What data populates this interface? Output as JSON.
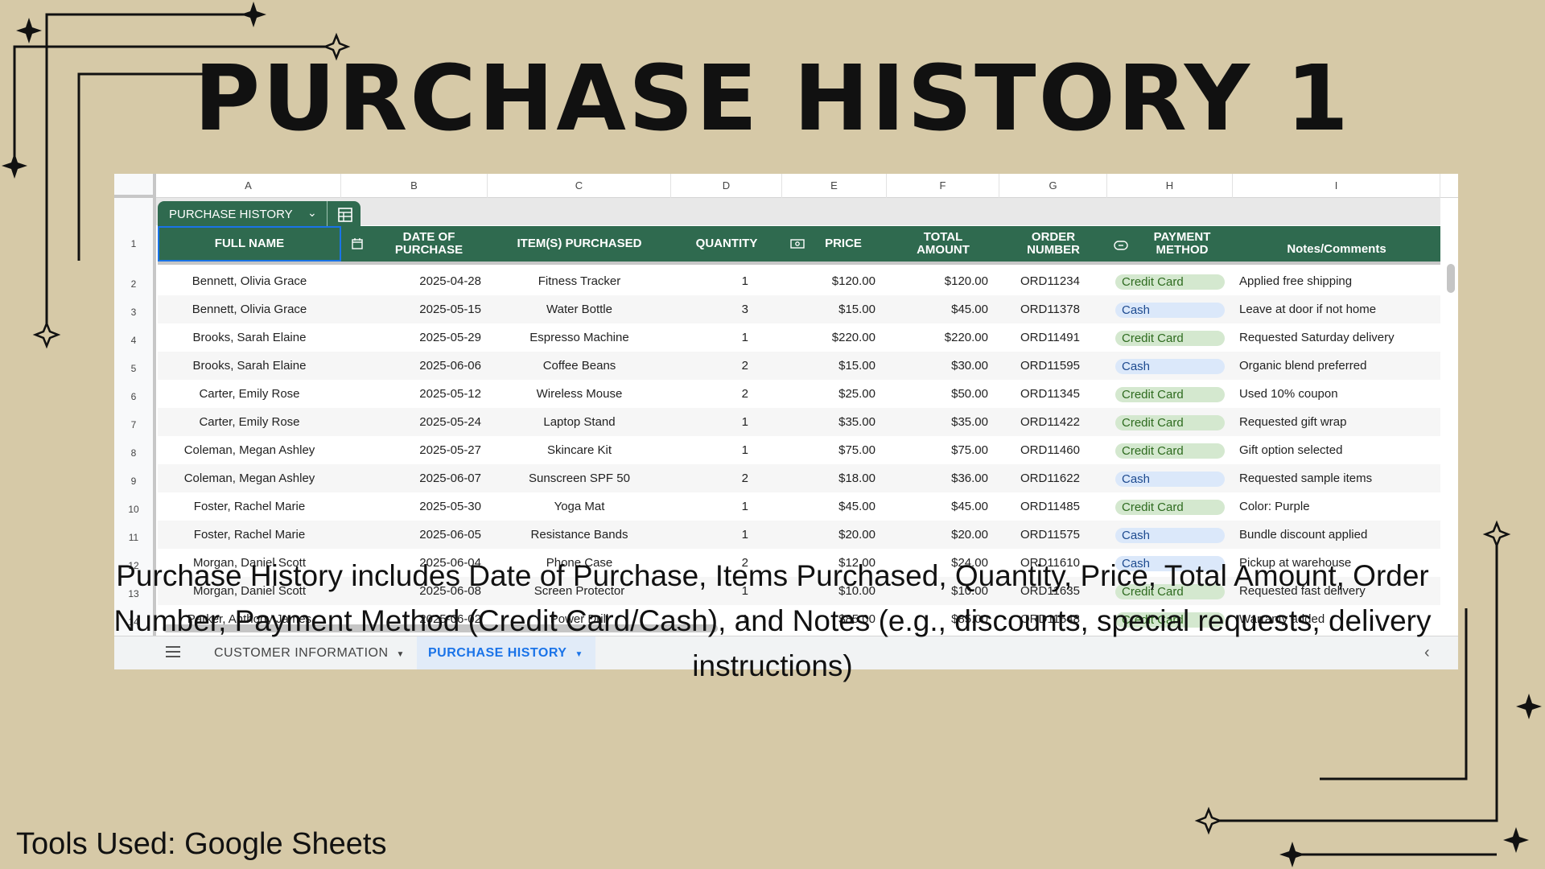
{
  "page": {
    "title": "PURCHASE HISTORY 1",
    "description": "Purchase History includes Date of Purchase, Items Purchased, Quantity, Price, Total Amount, Order Number, Payment Method (Credit Card/Cash), and Notes (e.g., discounts, special requests, delivery instructions)",
    "tools": "Tools Used: Google Sheets"
  },
  "colors": {
    "background": "#d6c9a7",
    "header_green": "#2f6a4f",
    "credit_card_chip": "#d4e8cf",
    "cash_chip": "#dbe8fa",
    "active_tab": "#1a73e8"
  },
  "sheet": {
    "column_letters": [
      "A",
      "B",
      "C",
      "D",
      "E",
      "F",
      "G",
      "H",
      "I"
    ],
    "row_numbers": [
      "1",
      "2",
      "3",
      "4",
      "5",
      "6",
      "7",
      "8",
      "9",
      "10",
      "11",
      "12",
      "13",
      "14"
    ],
    "table_name": "PURCHASE HISTORY",
    "headers": {
      "full_name": "FULL NAME",
      "date": "DATE OF\nPURCHASE",
      "items": "ITEM(S) PURCHASED",
      "quantity": "QUANTITY",
      "price": "PRICE",
      "total": "TOTAL\nAMOUNT",
      "order": "ORDER\nNUMBER",
      "payment": "PAYMENT\nMETHOD",
      "notes": "Notes/Comments"
    },
    "header_icons": {
      "table": "table-icon",
      "date": "calendar-icon",
      "price": "money-icon",
      "payment": "dropdown-chip-icon",
      "table_menu": "chevron-down-icon"
    },
    "rows": [
      {
        "name": "Bennett, Olivia Grace",
        "date": "2025-04-28",
        "item": "Fitness Tracker",
        "qty": "1",
        "price": "$120.00",
        "total": "$120.00",
        "order": "ORD11234",
        "payment": "Credit Card",
        "notes": "Applied free shipping"
      },
      {
        "name": "Bennett, Olivia Grace",
        "date": "2025-05-15",
        "item": "Water Bottle",
        "qty": "3",
        "price": "$15.00",
        "total": "$45.00",
        "order": "ORD11378",
        "payment": "Cash",
        "notes": "Leave at door if not home"
      },
      {
        "name": "Brooks, Sarah Elaine",
        "date": "2025-05-29",
        "item": "Espresso Machine",
        "qty": "1",
        "price": "$220.00",
        "total": "$220.00",
        "order": "ORD11491",
        "payment": "Credit Card",
        "notes": "Requested Saturday delivery"
      },
      {
        "name": "Brooks, Sarah Elaine",
        "date": "2025-06-06",
        "item": "Coffee Beans",
        "qty": "2",
        "price": "$15.00",
        "total": "$30.00",
        "order": "ORD11595",
        "payment": "Cash",
        "notes": "Organic blend preferred"
      },
      {
        "name": "Carter, Emily Rose",
        "date": "2025-05-12",
        "item": "Wireless Mouse",
        "qty": "2",
        "price": "$25.00",
        "total": "$50.00",
        "order": "ORD11345",
        "payment": "Credit Card",
        "notes": "Used 10% coupon"
      },
      {
        "name": "Carter, Emily Rose",
        "date": "2025-05-24",
        "item": "Laptop Stand",
        "qty": "1",
        "price": "$35.00",
        "total": "$35.00",
        "order": "ORD11422",
        "payment": "Credit Card",
        "notes": "Requested gift wrap"
      },
      {
        "name": "Coleman, Megan Ashley",
        "date": "2025-05-27",
        "item": "Skincare Kit",
        "qty": "1",
        "price": "$75.00",
        "total": "$75.00",
        "order": "ORD11460",
        "payment": "Credit Card",
        "notes": "Gift option selected"
      },
      {
        "name": "Coleman, Megan Ashley",
        "date": "2025-06-07",
        "item": "Sunscreen SPF 50",
        "qty": "2",
        "price": "$18.00",
        "total": "$36.00",
        "order": "ORD11622",
        "payment": "Cash",
        "notes": "Requested sample items"
      },
      {
        "name": "Foster, Rachel Marie",
        "date": "2025-05-30",
        "item": "Yoga Mat",
        "qty": "1",
        "price": "$45.00",
        "total": "$45.00",
        "order": "ORD11485",
        "payment": "Credit Card",
        "notes": "Color: Purple"
      },
      {
        "name": "Foster, Rachel Marie",
        "date": "2025-06-05",
        "item": "Resistance Bands",
        "qty": "1",
        "price": "$20.00",
        "total": "$20.00",
        "order": "ORD11575",
        "payment": "Cash",
        "notes": "Bundle discount applied"
      },
      {
        "name": "Morgan, Daniel Scott",
        "date": "2025-06-04",
        "item": "Phone Case",
        "qty": "2",
        "price": "$12.00",
        "total": "$24.00",
        "order": "ORD11610",
        "payment": "Cash",
        "notes": "Pickup at warehouse"
      },
      {
        "name": "Morgan, Daniel Scott",
        "date": "2025-06-08",
        "item": "Screen Protector",
        "qty": "1",
        "price": "$10.00",
        "total": "$10.00",
        "order": "ORD11635",
        "payment": "Credit Card",
        "notes": "Requested fast delivery"
      },
      {
        "name": "Parker, Anthony James",
        "date": "2025-06-02",
        "item": "Power Drill",
        "qty": "1",
        "price": "$85.00",
        "total": "$85.00",
        "order": "ORD11548",
        "payment": "Credit Card",
        "notes": "Warranty added"
      }
    ],
    "tabs": [
      {
        "label": "CUSTOMER INFORMATION",
        "active": false
      },
      {
        "label": "PURCHASE HISTORY",
        "active": true
      }
    ]
  }
}
